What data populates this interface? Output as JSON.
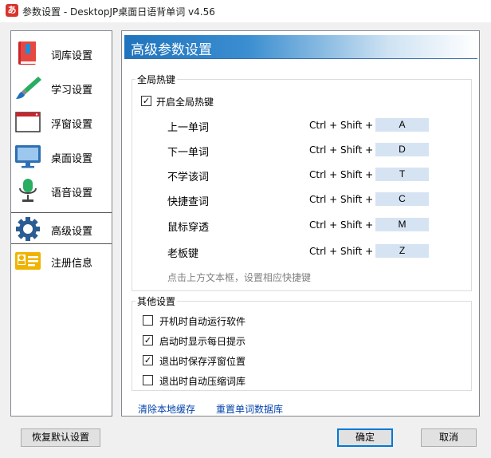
{
  "window": {
    "app_icon_glyph": "あ",
    "title": "参数设置 - DesktopJP桌面日语背单词 v4.56"
  },
  "sidebar": {
    "items": [
      {
        "label": "词库设置",
        "icon": "book-icon"
      },
      {
        "label": "学习设置",
        "icon": "paintbrush-icon"
      },
      {
        "label": "浮窗设置",
        "icon": "window-icon"
      },
      {
        "label": "桌面设置",
        "icon": "monitor-icon"
      },
      {
        "label": "语音设置",
        "icon": "microphone-icon"
      },
      {
        "label": "高级设置",
        "icon": "gear-icon",
        "active": true
      },
      {
        "label": "注册信息",
        "icon": "id-card-icon"
      }
    ]
  },
  "panel": {
    "title": "高级参数设置",
    "hotkeys_group": {
      "legend": "全局热键",
      "enable_label": "开启全局热键",
      "enable_checked": true,
      "items": [
        {
          "label": "上一单词",
          "modifier": "Ctrl + Shift +",
          "key": "A"
        },
        {
          "label": "下一单词",
          "modifier": "Ctrl + Shift +",
          "key": "D"
        },
        {
          "label": "不学该词",
          "modifier": "Ctrl + Shift +",
          "key": "T"
        },
        {
          "label": "快捷查词",
          "modifier": "Ctrl + Shift +",
          "key": "C"
        },
        {
          "label": "鼠标穿透",
          "modifier": "Ctrl + Shift +",
          "key": "M"
        },
        {
          "label": "老板键",
          "modifier": "Ctrl + Shift +",
          "key": "Z"
        }
      ],
      "hint": "点击上方文本框，设置相应快捷键"
    },
    "other_group": {
      "legend": "其他设置",
      "items": [
        {
          "label": "开机时自动运行软件",
          "checked": false
        },
        {
          "label": "启动时显示每日提示",
          "checked": true
        },
        {
          "label": "退出时保存浮窗位置",
          "checked": true
        },
        {
          "label": "退出时自动压缩词库",
          "checked": false
        }
      ]
    },
    "links": {
      "clear_cache": "清除本地缓存",
      "reset_db": "重置单词数据库"
    }
  },
  "footer": {
    "restore_defaults": "恢复默认设置",
    "ok": "确定",
    "cancel": "取消"
  },
  "colors": {
    "header_gradient_start": "#1f74bd",
    "key_box": "#d6e3f2",
    "link": "#0645ad",
    "default_button_border": "#0078d7"
  }
}
